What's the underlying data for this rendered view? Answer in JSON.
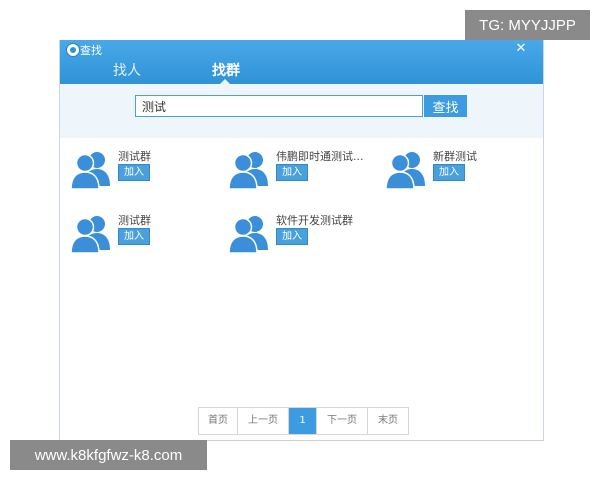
{
  "watermark_top": "TG: MYYJJPP",
  "watermark_bottom": "www.k8kfgfwz-k8.com",
  "window": {
    "title": "查找",
    "close": "✕"
  },
  "tabs": [
    {
      "label": "找人"
    },
    {
      "label": "找群",
      "active": true
    }
  ],
  "search": {
    "value": "测试",
    "button_label": "查找"
  },
  "results": [
    {
      "name": "测试群",
      "join_label": "加入"
    },
    {
      "name": "伟鹏即时通测试...",
      "join_label": "加入"
    },
    {
      "name": "新群测试",
      "join_label": "加入"
    },
    {
      "name": "测试群",
      "join_label": "加入"
    },
    {
      "name": "软件开发测试群",
      "join_label": "加入"
    }
  ],
  "pagination": {
    "first": "首页",
    "prev": "上一页",
    "current": "1",
    "next": "下一页",
    "last": "末页"
  },
  "colors": {
    "titlebar": "#3a9ee0",
    "accent": "#3d9ce0",
    "avatar": "#3a8fd8"
  }
}
